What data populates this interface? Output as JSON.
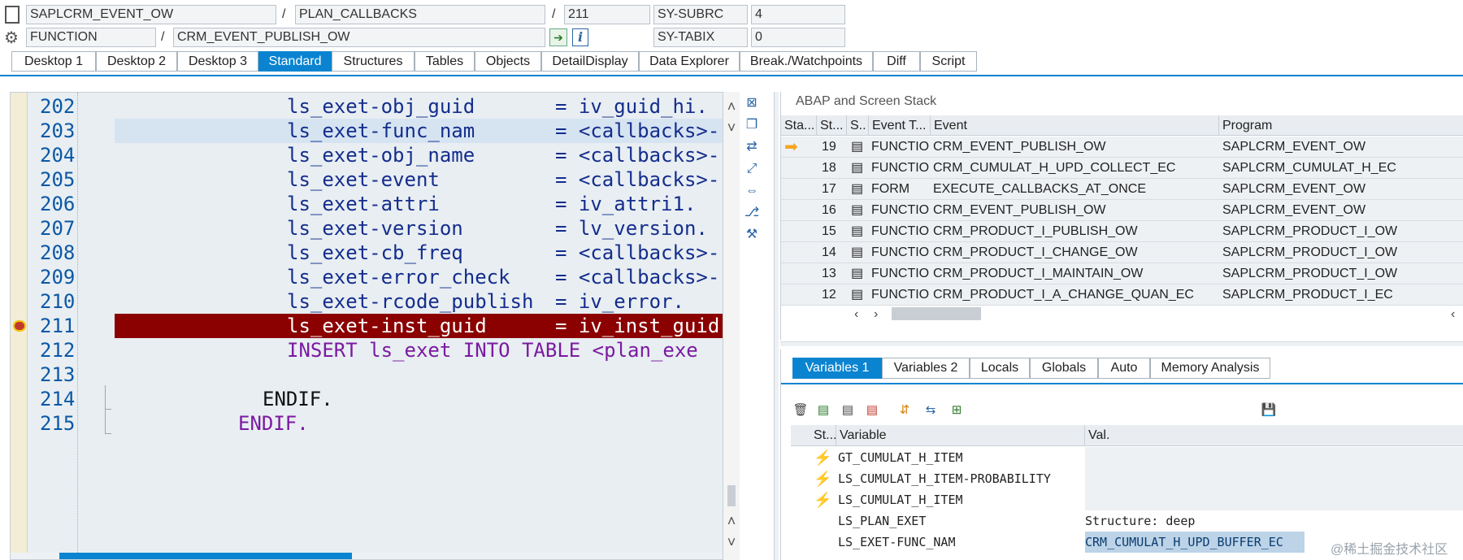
{
  "header": {
    "program": "SAPLCRM_EVENT_OW",
    "include": "PLAN_CALLBACKS",
    "line": "211",
    "subrc_label": "SY-SUBRC",
    "subrc_value": "4",
    "type": "FUNCTION",
    "name": "CRM_EVENT_PUBLISH_OW",
    "tabix_label": "SY-TABIX",
    "tabix_value": "0",
    "sep": "/"
  },
  "tabs": [
    {
      "label": "Desktop 1"
    },
    {
      "label": "Desktop 2"
    },
    {
      "label": "Desktop 3"
    },
    {
      "label": "Standard"
    },
    {
      "label": "Structures"
    },
    {
      "label": "Tables"
    },
    {
      "label": "Objects"
    },
    {
      "label": "DetailDisplay"
    },
    {
      "label": "Data Explorer"
    },
    {
      "label": "Break./Watchpoints"
    },
    {
      "label": "Diff"
    },
    {
      "label": "Script"
    }
  ],
  "editor": {
    "lines": [
      {
        "num": "202",
        "a": "ls_exet-obj_guid",
        "b": "= iv_guid_hi."
      },
      {
        "num": "203",
        "a": "ls_exet-func_nam",
        "b": "= <callbacks>-"
      },
      {
        "num": "204",
        "a": "ls_exet-obj_name",
        "b": "= <callbacks>-"
      },
      {
        "num": "205",
        "a": "ls_exet-event",
        "b": "= <callbacks>-"
      },
      {
        "num": "206",
        "a": "ls_exet-attri",
        "b": "= iv_attri1."
      },
      {
        "num": "207",
        "a": "ls_exet-version",
        "b": "= lv_version."
      },
      {
        "num": "208",
        "a": "ls_exet-cb_freq",
        "b": "= <callbacks>-"
      },
      {
        "num": "209",
        "a": "ls_exet-error_check",
        "b": "= <callbacks>-"
      },
      {
        "num": "210",
        "a": "ls_exet-rcode_publish",
        "b": "= iv_error."
      },
      {
        "num": "211",
        "a": "ls_exet-inst_guid",
        "b": "= iv_inst_guid"
      },
      {
        "num": "212",
        "a": "INSERT ls_exet INTO TABLE <plan_exe"
      },
      {
        "num": "213",
        "a": ""
      },
      {
        "num": "214",
        "a": "ENDIF."
      },
      {
        "num": "215",
        "a": "ENDIF."
      }
    ]
  },
  "stack": {
    "title": "ABAP and Screen Stack",
    "columns": [
      "Sta...",
      "St...",
      "S..",
      "Event T...",
      "Event",
      "Program"
    ],
    "rows": [
      {
        "level": "19",
        "type": "FUNCTIO...",
        "event": "CRM_EVENT_PUBLISH_OW",
        "program": "SAPLCRM_EVENT_OW",
        "current": true
      },
      {
        "level": "18",
        "type": "FUNCTIO...",
        "event": "CRM_CUMULAT_H_UPD_COLLECT_EC",
        "program": "SAPLCRM_CUMULAT_H_EC"
      },
      {
        "level": "17",
        "type": "FORM",
        "event": "EXECUTE_CALLBACKS_AT_ONCE",
        "program": "SAPLCRM_EVENT_OW"
      },
      {
        "level": "16",
        "type": "FUNCTIO...",
        "event": "CRM_EVENT_PUBLISH_OW",
        "program": "SAPLCRM_EVENT_OW"
      },
      {
        "level": "15",
        "type": "FUNCTIO...",
        "event": "CRM_PRODUCT_I_PUBLISH_OW",
        "program": "SAPLCRM_PRODUCT_I_OW"
      },
      {
        "level": "14",
        "type": "FUNCTIO...",
        "event": "CRM_PRODUCT_I_CHANGE_OW",
        "program": "SAPLCRM_PRODUCT_I_OW"
      },
      {
        "level": "13",
        "type": "FUNCTIO...",
        "event": "CRM_PRODUCT_I_MAINTAIN_OW",
        "program": "SAPLCRM_PRODUCT_I_OW"
      },
      {
        "level": "12",
        "type": "FUNCTIO...",
        "event": "CRM_PRODUCT_I_A_CHANGE_QUAN_EC",
        "program": "SAPLCRM_PRODUCT_I_EC"
      }
    ]
  },
  "variables": {
    "tabs": [
      "Variables 1",
      "Variables 2",
      "Locals",
      "Globals",
      "Auto",
      "Memory Analysis"
    ],
    "columns": [
      "St...",
      "Variable",
      "Val."
    ],
    "rows": [
      {
        "name": "GT_CUMULAT_H_ITEM",
        "value": "",
        "flag": true
      },
      {
        "name": "LS_CUMULAT_H_ITEM-PROBABILITY",
        "value": "",
        "flag": true
      },
      {
        "name": "LS_CUMULAT_H_ITEM",
        "value": "",
        "flag": true
      },
      {
        "name": "LS_PLAN_EXET",
        "value": "Structure: deep",
        "flag": false
      },
      {
        "name": "LS_EXET-FUNC_NAM",
        "value": "CRM_CUMULAT_H_UPD_BUFFER_EC",
        "flag": false
      }
    ]
  },
  "watermark": "@稀土掘金技术社区",
  "colors": {
    "accent": "#0a84d0",
    "breakpoint": "#8b0000"
  }
}
